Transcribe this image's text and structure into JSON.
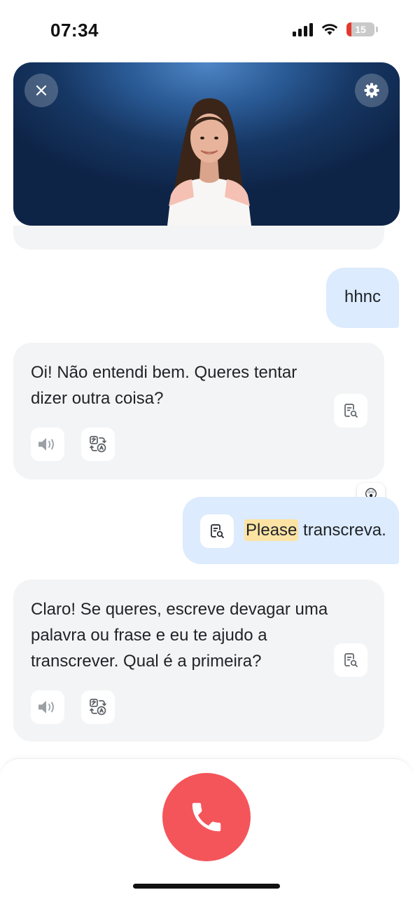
{
  "status_bar": {
    "time": "07:34",
    "battery_level": "15",
    "icons": [
      "signal-icon",
      "wifi-icon",
      "battery-icon"
    ]
  },
  "video_call": {
    "close_icon": "close-icon",
    "settings_icon": "gear-icon"
  },
  "messages": [
    {
      "role": "user",
      "text": "hhnc"
    },
    {
      "role": "assistant",
      "text": "Oi! Não entendi bem. Queres tentar dizer outra coisa?",
      "actions": [
        "transcript-search-icon",
        "speaker-icon",
        "translate-icon"
      ]
    },
    {
      "role": "user",
      "highlight": "Please",
      "rest": " transcreva.",
      "reaction": "😲"
    },
    {
      "role": "assistant",
      "text": "Claro! Se queres, escreve devagar uma palavra ou frase e eu te ajudo a transcrever. Qual é a primeira?",
      "actions": [
        "transcript-search-icon",
        "speaker-icon",
        "translate-icon"
      ]
    }
  ],
  "colors": {
    "user_bubble": "#dcebfd",
    "assistant_bubble": "#f3f4f5",
    "highlight": "#fde3a3",
    "hangup": "#f4555a"
  }
}
